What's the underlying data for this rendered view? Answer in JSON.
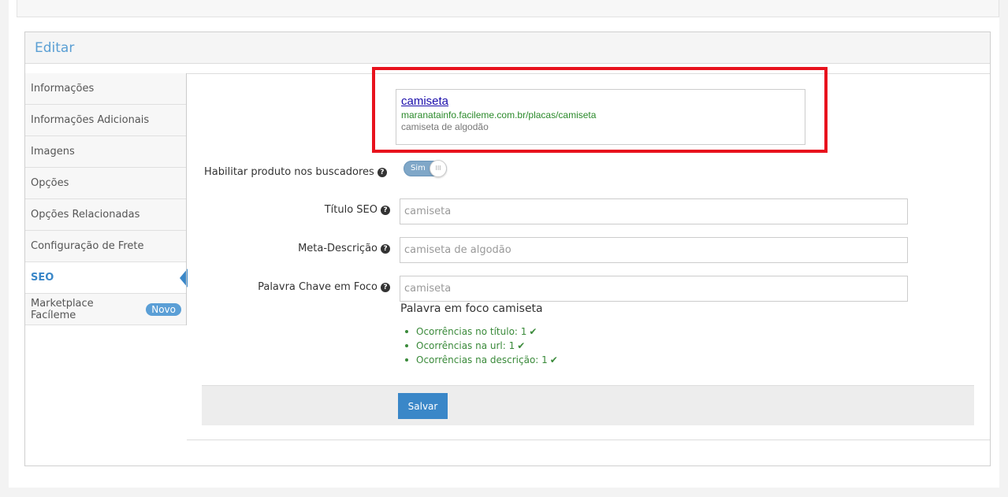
{
  "panel": {
    "title": "Editar"
  },
  "sidebar": {
    "items": [
      {
        "label": "Informações"
      },
      {
        "label": "Informações Adicionais"
      },
      {
        "label": "Imagens"
      },
      {
        "label": "Opções"
      },
      {
        "label": "Opções Relacionadas"
      },
      {
        "label": "Configuração de Frete"
      },
      {
        "label": "SEO",
        "active": true
      },
      {
        "label": "Marketplace Facíleme",
        "badge": "Novo"
      }
    ]
  },
  "preview": {
    "title": "camiseta",
    "url": "maranatainfo.facileme.com.br/placas/camiseta",
    "description": "camiseta de algodão"
  },
  "form": {
    "enable_label": "Habilitar produto nos buscadores",
    "toggle_value": "Sim",
    "toggle_knob": "III",
    "seo_title_label": "Título SEO",
    "seo_title_value": "camiseta",
    "meta_label": "Meta-Descrição",
    "meta_value": "camiseta de algodão",
    "keyword_label": "Palavra Chave em Foco",
    "keyword_value": "camiseta",
    "help_icon": "?"
  },
  "focus": {
    "title": "Palavra em foco camiseta",
    "checks": [
      {
        "label": "Ocorrências no título: 1"
      },
      {
        "label": "Ocorrências na url: 1"
      },
      {
        "label": "Ocorrências na descrição: 1"
      }
    ],
    "check_icon": "✔"
  },
  "actions": {
    "save_label": "Salvar"
  },
  "colors": {
    "accent": "#3a87c8",
    "highlight_frame": "#e8121d",
    "ok": "#3a8a3a"
  }
}
